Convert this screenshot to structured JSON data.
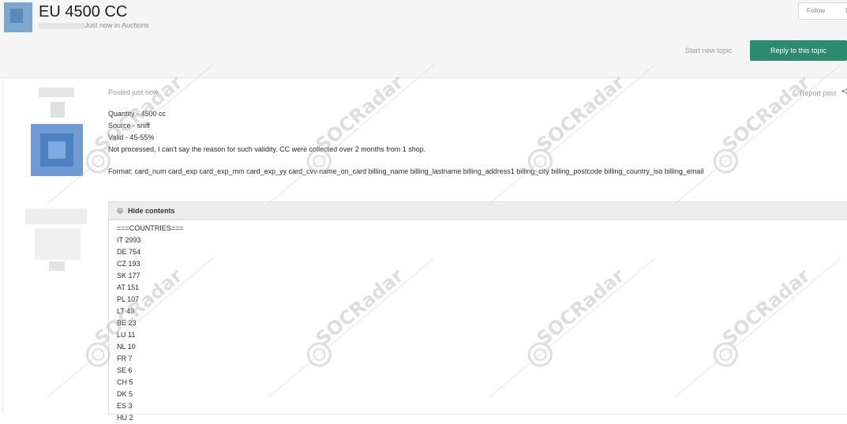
{
  "header": {
    "title": "EU 4500 CC",
    "meta_suffix": "Just now in Auctions",
    "follow_label": "Follow",
    "follow_count": "1"
  },
  "actions": {
    "start_new_topic": "Start new topic",
    "reply": "Reply to this topic"
  },
  "post": {
    "posted": "Posted just now",
    "report": "Report post",
    "lines": [
      "Quantity - 4500 cc",
      "Source - sniff",
      "Valid - 45-55%",
      "Not processed, I can't say the reason for such validity. CC were collected over 2 months from 1 shop."
    ],
    "format": "Format: card_num card_exp card_exp_mm card_exp_yy card_cvv name_on_card billing_name billing_lastname billing_address1 billing_city billing_postcode billing_country_iso billing_email",
    "hidden": {
      "label": "Hide contents",
      "items": [
        "===COUNTRIES===",
        "IT 2993",
        "DE 754",
        "CZ 193",
        "SK 177",
        "AT 151",
        "PL 107",
        "LT 49",
        "BE 23",
        "LU 11",
        "NL 10",
        "FR 7",
        "SE 6",
        "CH 5",
        "DK 5",
        "ES 3",
        "HU 2"
      ]
    }
  },
  "watermark": {
    "text": "SOCRadar",
    "color": "#b8b8b8"
  }
}
